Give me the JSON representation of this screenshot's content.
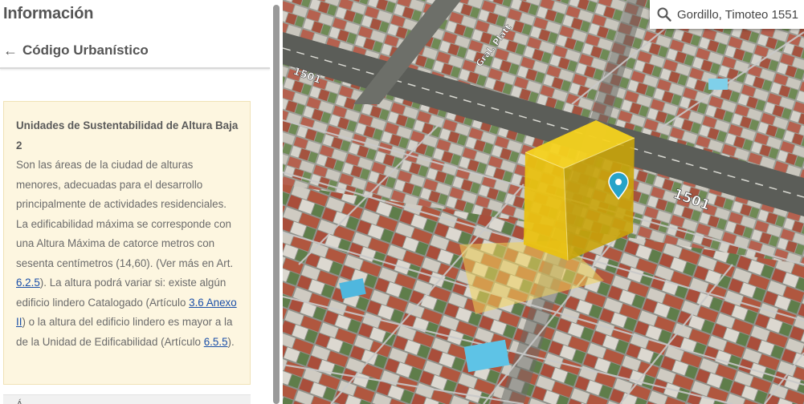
{
  "sidebar": {
    "title": "Información",
    "back_arrow": "←",
    "back_label": "Código Urbanístico",
    "card": {
      "title": "Unidades de Sustentabilidad de Altura Baja 2",
      "body_1": "Son las áreas de la ciudad de alturas menores, adecuadas para el desarrollo principalmente de actividades residenciales. La edificabilidad máxima se corresponde con una Altura Máxima de catorce metros con sesenta centímetros (14,60). (Ver más en Art. ",
      "link_1": "6.2.5",
      "body_2": "). La altura podrá variar si: existe algún edificio lindero Catalogado (Artículo ",
      "link_2": "3.6 Anexo II",
      "body_3": ") o la altura del edificio lindero es mayor a la de la Unidad de Edificabilidad (Artículo ",
      "link_3": "6.5.5",
      "body_4": ")."
    },
    "next_card_label": "Á"
  },
  "map": {
    "search_value": "Gordillo, Timoteo 1551",
    "street_number_label": "1501",
    "street_number_label_far": "1501",
    "street_name_label": "Gral. Platt",
    "volume_color": "#f2c400",
    "pin_color": "#26a3c9"
  }
}
